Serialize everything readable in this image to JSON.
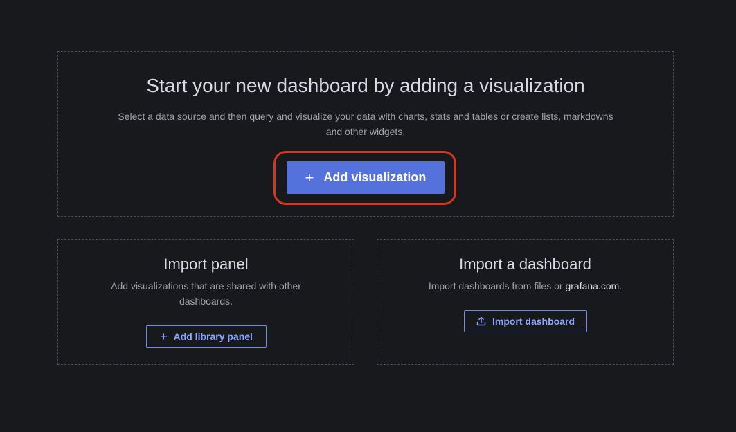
{
  "main": {
    "title": "Start your new dashboard by adding a visualization",
    "description": "Select a data source and then query and visualize your data with charts, stats and tables or create lists, markdowns and other widgets.",
    "button_label": "Add visualization",
    "button_icon": "plus-icon"
  },
  "import_panel": {
    "title": "Import panel",
    "description": "Add visualizations that are shared with other dashboards.",
    "button_label": "Add library panel",
    "button_icon": "plus-icon"
  },
  "import_dashboard": {
    "title": "Import a dashboard",
    "description_prefix": "Import dashboards from files or ",
    "description_link": "grafana.com",
    "description_suffix": ".",
    "button_label": "Import dashboard",
    "button_icon": "upload-icon"
  },
  "colors": {
    "background": "#18191d",
    "primary": "#5471dc",
    "highlight": "#d9341c",
    "outline_button": "#6e8ae6"
  }
}
